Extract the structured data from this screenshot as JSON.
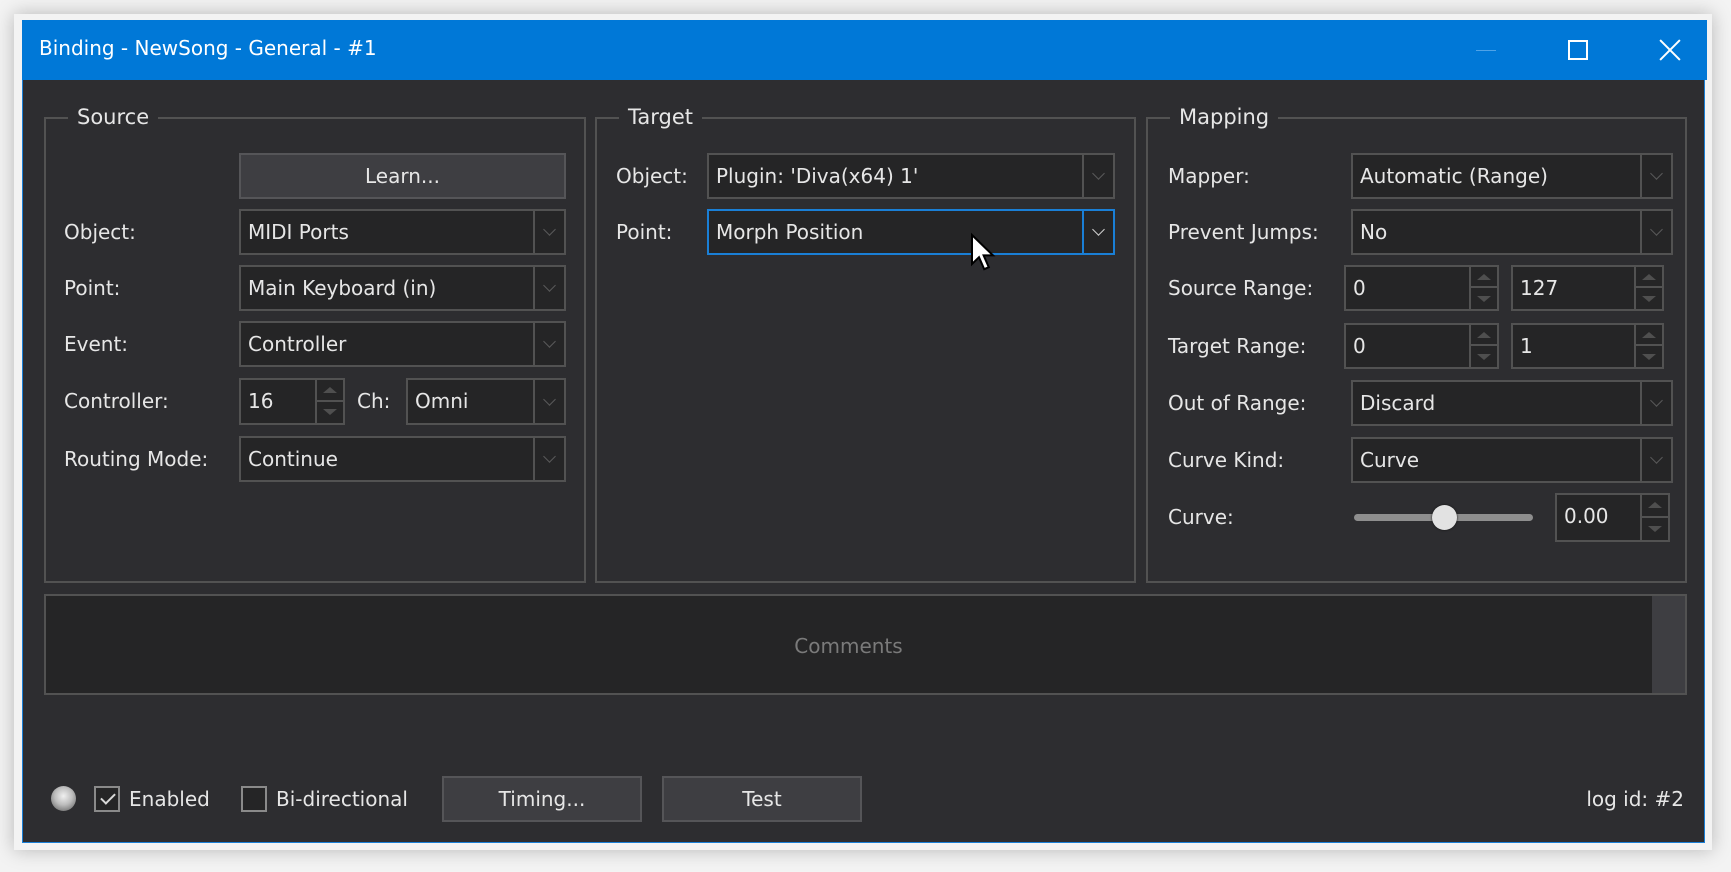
{
  "window": {
    "title": "Binding - NewSong - General - #1",
    "controls": {
      "minimize": "minimize-icon",
      "maximize": "maximize-icon",
      "close": "close-icon"
    },
    "accent_color": "#0078d7"
  },
  "source": {
    "title": "Source",
    "learn_label": "Learn...",
    "object_label": "Object:",
    "object_value": "MIDI Ports",
    "point_label": "Point:",
    "point_value": "Main Keyboard (in)",
    "event_label": "Event:",
    "event_value": "Controller",
    "controller_label": "Controller:",
    "controller_value": "16",
    "channel_label": "Ch:",
    "channel_value": "Omni",
    "routing_label": "Routing Mode:",
    "routing_value": "Continue"
  },
  "target": {
    "title": "Target",
    "object_label": "Object:",
    "object_value": "Plugin: 'Diva(x64) 1'",
    "point_label": "Point:",
    "point_value": "Morph Position"
  },
  "mapping": {
    "title": "Mapping",
    "mapper_label": "Mapper:",
    "mapper_value": "Automatic (Range)",
    "prevent_jumps_label": "Prevent Jumps:",
    "prevent_jumps_value": "No",
    "source_range_label": "Source Range:",
    "source_range_min": "0",
    "source_range_max": "127",
    "target_range_label": "Target Range:",
    "target_range_min": "0",
    "target_range_max": "1",
    "out_of_range_label": "Out of Range:",
    "out_of_range_value": "Discard",
    "curve_kind_label": "Curve Kind:",
    "curve_kind_value": "Curve",
    "curve_label": "Curve:",
    "curve_value": "0.00",
    "curve_slider_fraction": 0.5
  },
  "comments": {
    "placeholder": "Comments"
  },
  "footer": {
    "status_led": "status-led-icon",
    "enabled_label": "Enabled",
    "enabled_checked": true,
    "bidirectional_label": "Bi-directional",
    "bidirectional_checked": false,
    "timing_label": "Timing...",
    "test_label": "Test",
    "log_id": "log id: #2"
  }
}
